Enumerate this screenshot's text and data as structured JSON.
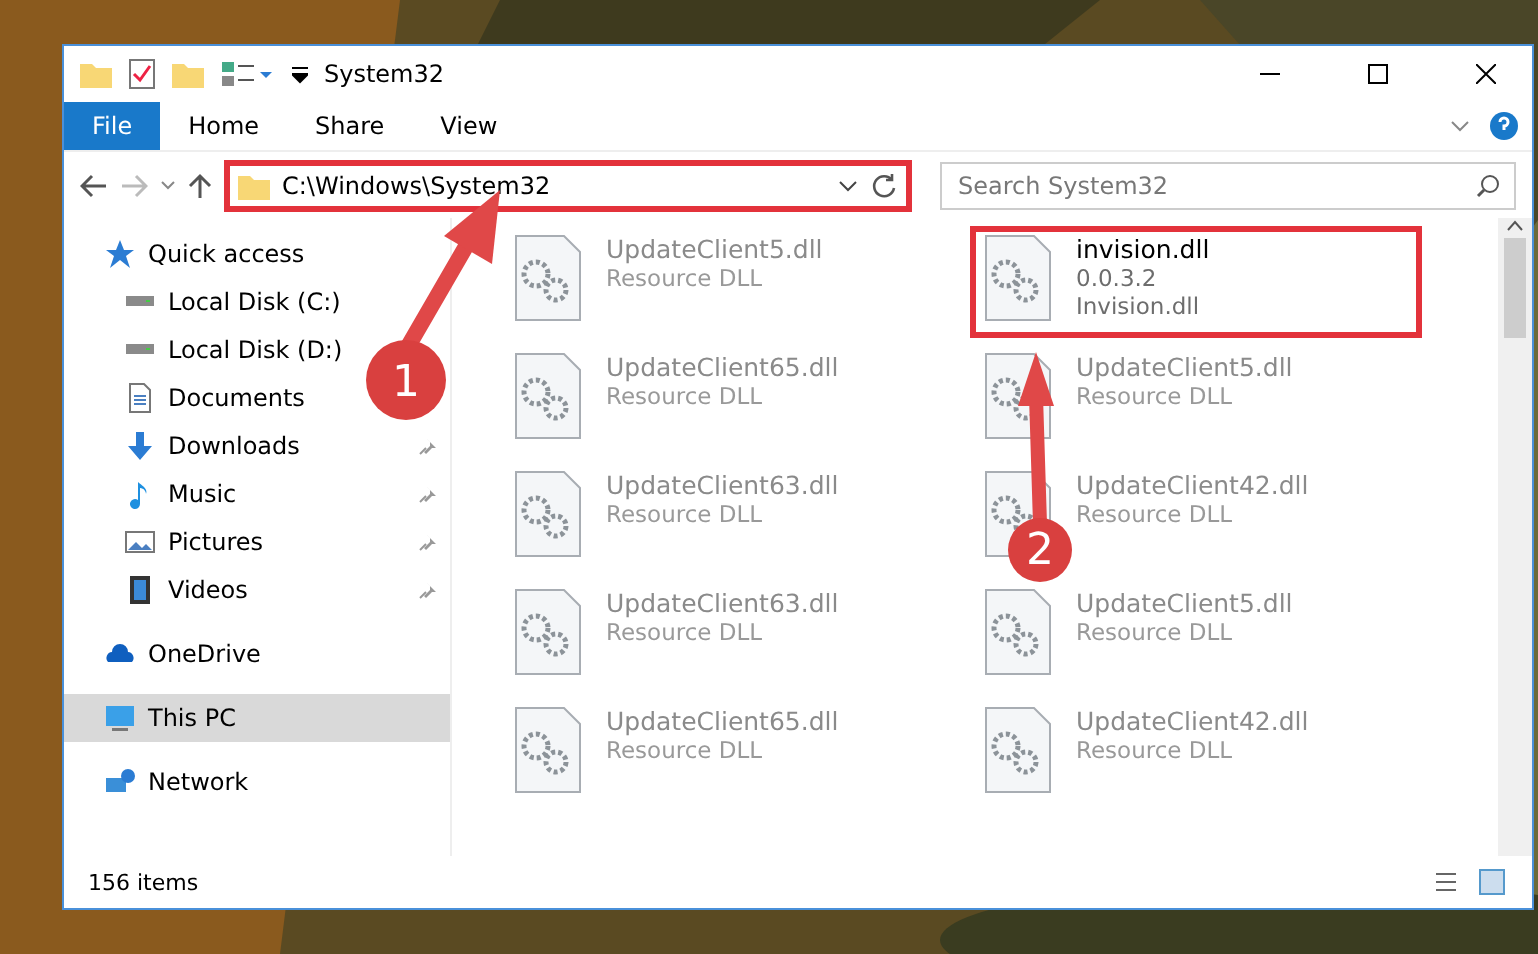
{
  "window": {
    "title": "System32"
  },
  "ribbon_tabs": [
    {
      "label": "File",
      "selected": true
    },
    {
      "label": "Home",
      "selected": false
    },
    {
      "label": "Share",
      "selected": false
    },
    {
      "label": "View",
      "selected": false
    }
  ],
  "address_bar": {
    "path": "C:\\Windows\\System32",
    "highlighted": true
  },
  "search": {
    "placeholder": "Search System32"
  },
  "sidebar": {
    "items": [
      {
        "label": "Quick access",
        "selected": false,
        "children": [
          {
            "label": "Local Disk (C:)",
            "selected": false
          },
          {
            "label": "Local Disk (D:)",
            "selected": false
          },
          {
            "label": "Documents",
            "selected": false
          },
          {
            "label": "Downloads",
            "selected": false,
            "pinned": true
          },
          {
            "label": "Music",
            "selected": false,
            "pinned": true
          },
          {
            "label": "Pictures",
            "selected": false,
            "pinned": true
          },
          {
            "label": "Videos",
            "selected": false,
            "pinned": true
          }
        ]
      },
      {
        "label": "OneDrive",
        "selected": false
      },
      {
        "label": "This PC",
        "selected": true
      },
      {
        "label": "Network",
        "selected": false
      }
    ]
  },
  "files": [
    {
      "name": "UpdateClient5.dll",
      "line_2": "Resource DLL",
      "faded": true,
      "highlighted": false
    },
    {
      "name": "invision.dll",
      "line_2": "0.0.3.2",
      "line_3": "Invision.dll",
      "faded": false,
      "highlighted": true
    },
    {
      "name": "UpdateClient65.dll",
      "line_2": "Resource DLL",
      "faded": true,
      "highlighted": false
    },
    {
      "name": "UpdateClient5.dll",
      "line_2": "Resource DLL",
      "faded": true,
      "highlighted": false
    },
    {
      "name": "UpdateClient63.dll",
      "line_2": "Resource DLL",
      "faded": true,
      "highlighted": false
    },
    {
      "name": "UpdateClient42.dll",
      "line_2": "Resource DLL",
      "faded": true,
      "highlighted": false
    },
    {
      "name": "UpdateClient63.dll",
      "line_2": "Resource DLL",
      "faded": true,
      "highlighted": false
    },
    {
      "name": "UpdateClient5.dll",
      "line_2": "Resource DLL",
      "faded": true,
      "highlighted": false
    },
    {
      "name": "UpdateClient65.dll",
      "line_2": "Resource DLL",
      "faded": true,
      "highlighted": false
    },
    {
      "name": "UpdateClient42.dll",
      "line_2": "Resource DLL",
      "faded": true,
      "highlighted": false
    }
  ],
  "status_bar": {
    "item_count": "156 items"
  },
  "callouts": [
    {
      "number": "1"
    },
    {
      "number": "2"
    }
  ]
}
